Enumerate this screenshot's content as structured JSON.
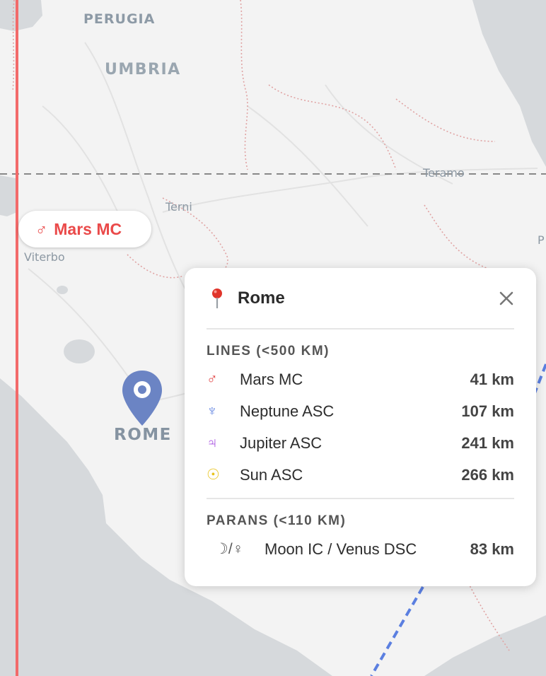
{
  "map": {
    "colors": {
      "land": "#f3f3f3",
      "sea": "#d6d9dc",
      "mars_line": "#f26a6a",
      "neptune_line": "#5b7fe0",
      "pin": "#6b84c4",
      "border": "#e0a3a3"
    },
    "labels": {
      "perugia": "PERUGIA",
      "umbria": "UMBRIA",
      "teramo": "Teramo",
      "terni": "Terni",
      "viterbo": "Viterbo",
      "p_edge": "P",
      "rome": "ROME"
    },
    "line_chip": {
      "symbol": "♂",
      "label": "Mars MC",
      "color": "#ea4a4a"
    },
    "pin_icon": "map-marker-icon"
  },
  "popup": {
    "icon": "round-pushpin-icon",
    "title": "Rome",
    "close_icon": "close-icon",
    "lines_title": "LINES (<500 KM)",
    "lines": [
      {
        "symbol": "♂",
        "name": "Mars MC",
        "distance": "41 km",
        "color": "#e24b4b"
      },
      {
        "symbol": "♆",
        "name": "Neptune ASC",
        "distance": "107 km",
        "color": "#5b7fe0"
      },
      {
        "symbol": "♃",
        "name": "Jupiter ASC",
        "distance": "241 km",
        "color": "#a64ee0"
      },
      {
        "symbol": "☉",
        "name": "Sun ASC",
        "distance": "266 km",
        "color": "#e8c21a"
      }
    ],
    "parans_title": "PARANS (<110 KM)",
    "parans": [
      {
        "symbol": "☽/♀",
        "name": "Moon IC / Venus DSC",
        "distance": "83 km"
      }
    ]
  }
}
